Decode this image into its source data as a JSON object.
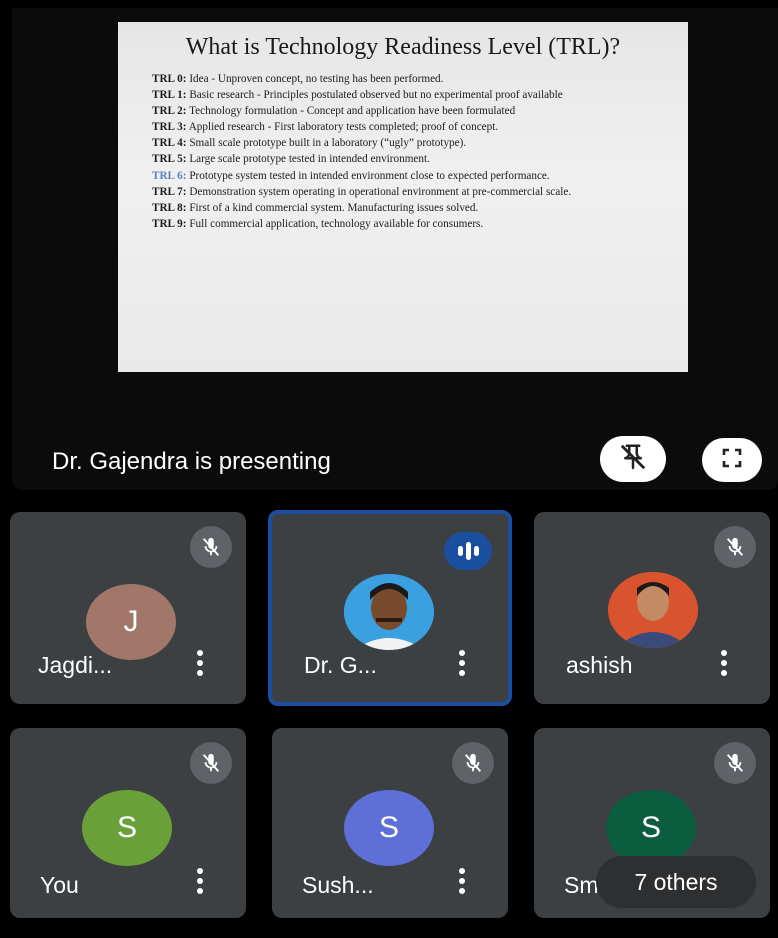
{
  "slide": {
    "title": "What is Technology Readiness Level (TRL)?",
    "items": [
      {
        "level": "TRL 0:",
        "text": "Idea - Unproven concept, no testing has been performed."
      },
      {
        "level": "TRL 1:",
        "text": "Basic research - Principles postulated observed but no experimental proof available"
      },
      {
        "level": "TRL 2:",
        "text": "Technology formulation - Concept and application have been formulated"
      },
      {
        "level": "TRL 3:",
        "text": "Applied research - First laboratory tests completed; proof of concept."
      },
      {
        "level": "TRL 4:",
        "text": "Small scale prototype built in a laboratory (“ugly” prototype)."
      },
      {
        "level": "TRL 5:",
        "text": "Large scale prototype tested in intended environment."
      },
      {
        "level": "TRL 6:",
        "text": "Prototype system tested in intended environment close to expected performance."
      },
      {
        "level": "TRL 7:",
        "text": "Demonstration system operating in operational environment at pre-commercial scale."
      },
      {
        "level": "TRL 8:",
        "text": "First of a kind commercial system. Manufacturing issues solved."
      },
      {
        "level": "TRL 9:",
        "text": "Full commercial application, technology available for consumers."
      }
    ]
  },
  "presenting_text": "Dr. Gajendra is presenting",
  "participants": [
    {
      "name": "Jagdi...",
      "initial": "J",
      "avatar_color": "#a1776a",
      "muted": true
    },
    {
      "name": "Dr. G...",
      "initial": "",
      "avatar_color": "#3aa0e0",
      "muted": false,
      "speaking": true
    },
    {
      "name": "ashish",
      "initial": "",
      "avatar_color": "#d9532f",
      "muted": true
    },
    {
      "name": "You",
      "initial": "S",
      "avatar_color": "#6aa038",
      "muted": true
    },
    {
      "name": "Sush...",
      "initial": "S",
      "avatar_color": "#5f6fd8",
      "muted": true
    },
    {
      "name": "Smita",
      "initial": "S",
      "avatar_color": "#0b5d3f",
      "muted": true
    }
  ],
  "others_label": "7 others",
  "colors": {
    "active_border": "#1a4fa0",
    "tile_bg": "#3c4043"
  }
}
